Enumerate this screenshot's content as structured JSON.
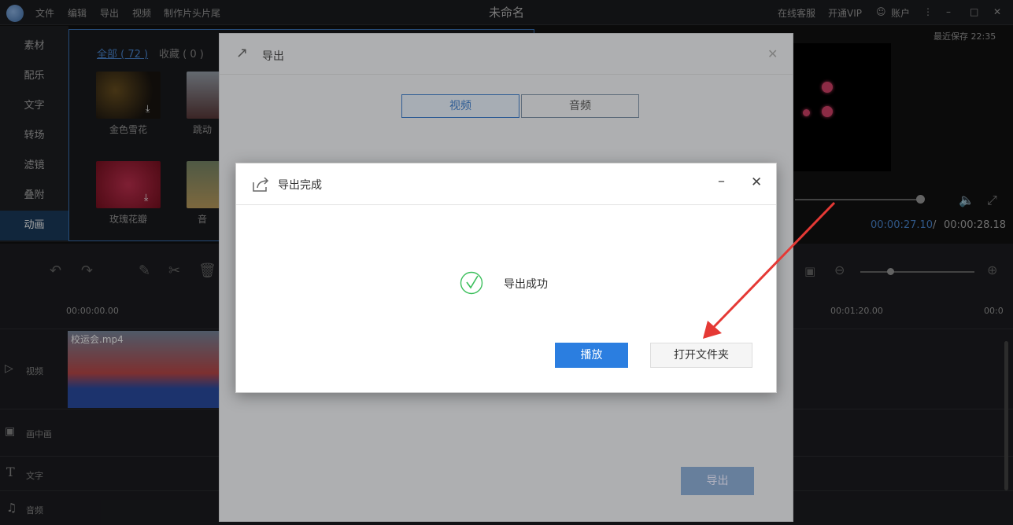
{
  "titlebar": {
    "menus": [
      "文件",
      "编辑",
      "导出",
      "视频",
      "制作片头片尾"
    ],
    "title": "未命名",
    "right": {
      "online_service": "在线客服",
      "vip": "开通VIP",
      "account": "账户"
    }
  },
  "categories": [
    "素材",
    "配乐",
    "文字",
    "转场",
    "滤镜",
    "叠附",
    "动画"
  ],
  "media": {
    "tabs": [
      "全部 ( 72 )",
      "收藏 ( 0 )"
    ],
    "items": [
      {
        "label": "金色雪花"
      },
      {
        "label": "跳动"
      },
      {
        "label": "玫瑰花瓣"
      },
      {
        "label": "音"
      }
    ]
  },
  "preview": {
    "last_saved": "最近保存 22:35",
    "current_time": "00:00:27.10",
    "separator": "/",
    "total_time": "00:00:28.18"
  },
  "timeline": {
    "ruler_start": "00:00:00.00",
    "ruler_mid": "00:01:20.00",
    "ruler_end": "00:0",
    "clip_name": "校运会.mp4",
    "tracks": [
      "视频",
      "画中画",
      "文字",
      "音频"
    ]
  },
  "export_dialog": {
    "title": "导出",
    "tabs": [
      "视频",
      "音频"
    ],
    "export_button": "导出"
  },
  "done_dialog": {
    "title": "导出完成",
    "message": "导出成功",
    "play_button": "播放",
    "open_folder_button": "打开文件夹"
  },
  "colors": {
    "accent": "#2b7ee0",
    "success": "#3cbf5c",
    "arrow": "#e53935"
  }
}
